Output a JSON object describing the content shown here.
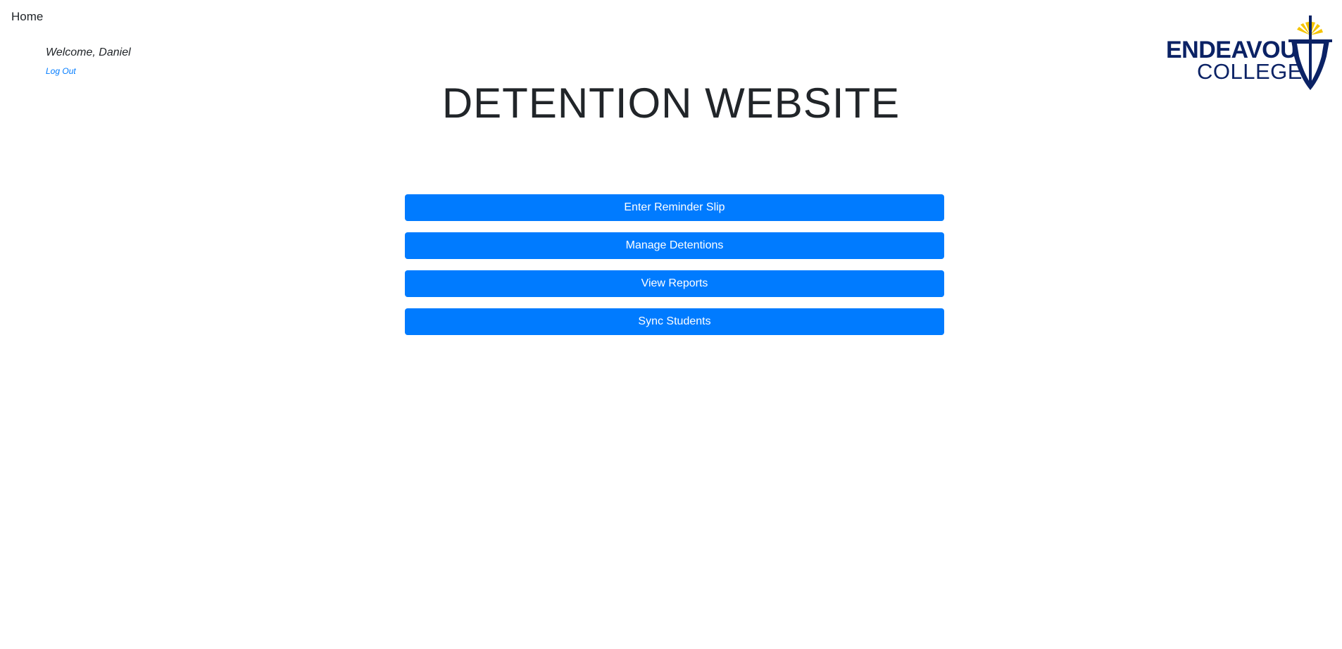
{
  "nav": {
    "home_label": "Home"
  },
  "user": {
    "welcome_text": "Welcome, Daniel",
    "logout_label": "Log Out"
  },
  "page": {
    "title": "DETENTION WEBSITE"
  },
  "logo": {
    "line1": "ENDEAVOUR",
    "line2": "COLLEGE",
    "icon": "college-crest-icon",
    "colors": {
      "navy": "#0b2265",
      "gold": "#f5c400"
    }
  },
  "menu": {
    "buttons": [
      {
        "label": "Enter Reminder Slip"
      },
      {
        "label": "Manage Detentions"
      },
      {
        "label": "View Reports"
      },
      {
        "label": "Sync Students"
      }
    ]
  },
  "colors": {
    "primary": "#007bff",
    "text": "#212529",
    "background": "#ffffff"
  }
}
